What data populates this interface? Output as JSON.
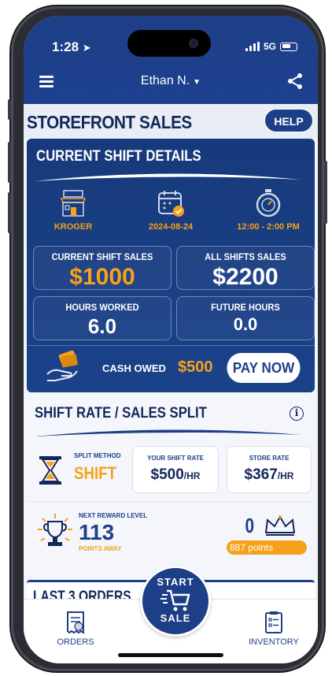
{
  "status": {
    "time": "1:28",
    "network": "5G"
  },
  "topbar": {
    "user_name": "Ethan N."
  },
  "page": {
    "title": "STOREFRONT SALES",
    "help_label": "HELP"
  },
  "shift": {
    "title": "CURRENT SHIFT DETAILS",
    "store": "KROGER",
    "date": "2024-08-24",
    "time_range": "12:00 - 2:00 PM",
    "current_sales_label": "CURRENT SHIFT SALES",
    "current_sales_value": "$1000",
    "all_sales_label": "ALL SHIFTS SALES",
    "all_sales_value": "$2200",
    "hours_worked_label": "HOURS WORKED",
    "hours_worked_value": "6.0",
    "future_hours_label": "FUTURE HOURS",
    "future_hours_value": "0.0",
    "cash_owed_label": "CASH OWED",
    "cash_owed_value": "$500",
    "pay_now_label": "PAY NOW"
  },
  "split": {
    "title": "SHIFT RATE / SALES SPLIT",
    "method_label": "SPLIT METHOD",
    "method_value": "SHIFT",
    "your_rate_label": "YOUR SHIFT RATE",
    "your_rate_value": "$500",
    "store_rate_label": "STORE RATE",
    "store_rate_value": "$367",
    "rate_unit": "/HR",
    "reward_label": "NEXT REWARD LEVEL",
    "reward_value": "113",
    "reward_sub": "POINTS AWAY",
    "crown_count": "0",
    "points": "887 points"
  },
  "orders": {
    "title": "LAST 3 ORDERS"
  },
  "nav": {
    "orders_label": "ORDERS",
    "start_top": "START",
    "start_bottom": "SALE",
    "inventory_label": "INVENTORY"
  },
  "colors": {
    "brand": "#1d3f87",
    "accent": "#f6a119"
  }
}
